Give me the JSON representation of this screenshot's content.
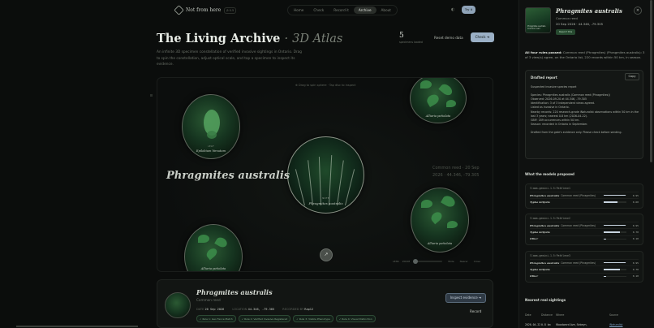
{
  "nav": {
    "logo_text": "Not from here",
    "logo_badge": "β 0.5",
    "tabs": [
      {
        "label": "Home",
        "active": false
      },
      {
        "label": "Check",
        "active": false
      },
      {
        "label": "Record it",
        "active": false
      },
      {
        "label": "Archive",
        "active": true
      },
      {
        "label": "About",
        "active": false
      }
    ],
    "glyph": "◐",
    "pill_label": "Try it"
  },
  "hero": {
    "title": "The Living Archive",
    "title_sep": "·",
    "title_sub": "3D Atlas",
    "intro": "An infinite 3D specimen constellation of verified invasive sightings in Ontario. Drag to spin the constellation, adjust optical scale, and tap a specimen to inspect its evidence.",
    "stat_count": "5",
    "stat_label": "specimens loaded",
    "reset_label": "Reset demo data",
    "check_label": "Check ➔"
  },
  "stage": {
    "hint": "⊕ Drag to spin sphere · Tap disc to inspect",
    "big_name": "Phragmites australis",
    "side_note": "Common reed · 20 Sep 2026 · 44.346, -79.305",
    "fab_icon": "↗",
    "slider_left": "LENS",
    "slider_zoom": "ZOOM",
    "slider_opts": [
      "Wide",
      "Nearer",
      "Close"
    ],
    "specimens": [
      {
        "label": "Epilobium hirsutum",
        "caps": "LEAF"
      },
      {
        "label": "Alliaria petiolata",
        "caps": ""
      },
      {
        "label": "Phragmites australis",
        "caps": "NOTE"
      },
      {
        "label": "Alliaria petiolata",
        "caps": ""
      },
      {
        "label": "Alliaria petiolata",
        "caps": ""
      }
    ]
  },
  "card": {
    "title": "Phragmites australis",
    "subtitle": "Common reed",
    "date_label": "DATE",
    "date_value": "20 Sep 2026",
    "loc_label": "LOCATION",
    "loc_value": "44.346, -79.305",
    "recorded_label": "RECORDED BY",
    "recorded_value": "Rap12",
    "tags": [
      "✓ Rule 1: Geo Fence Match",
      "✓ Rule 2: Verified Invasive Registered",
      "✓ Rule 3: Visible Phenotype",
      "✓ Rule 4: Visual Distinction"
    ],
    "inspect_label": "Inspect evidence ➔",
    "record_label": "Record"
  },
  "panel": {
    "thumb_caption": "Phragmites australis Common reed",
    "name": "Phragmites australis",
    "common": "Common reed",
    "observed": "20 Sep 2026 · 44.346, -79.305",
    "report_btn": "Report this",
    "close_icon": "×",
    "rules_lead": "All four rules passed:",
    "rules_text": " Common reed (Phragmites) (Phragmites australis): 3 of 3 view(s) agree, on the Ontario list, 220 records within 50 km, in season.",
    "draft": {
      "title": "Drafted report",
      "copy_label": "Copy",
      "heading": "Suspected invasive species report",
      "lines": [
        "Species: Phragmites australis (Common reed (Phragmites))",
        "Observed: 2026-09-20 at 44.346, -79.305",
        "Identification: 3 of 3 independent views agreed.",
        "Listed as invasive in Ontario.",
        "Nearby records: 220 research-grade iNaturalist observations within 50 km in the last 3 years; nearest 0.8 km (2026-04-22).",
        "GBIF: 189 occurrences within 50 km.",
        "Season: recorded in Ontario in September."
      ],
      "footer": "Drafted from the gate's evidence only. Please check before sending."
    },
    "models_title": "What the models proposed",
    "models": [
      {
        "id": "llama-gemini-1.5:Pathlene1",
        "rows": [
          {
            "sci": "Phragmites australis",
            "common": "Common reed (Phragmites)",
            "value": 0.95
          },
          {
            "sci": "Typha latifolia",
            "common": "",
            "value": 0.6
          }
        ]
      },
      {
        "id": "llama-gemini-1.5:Pathlene2",
        "rows": [
          {
            "sci": "Phragmites australis",
            "common": "Common reed (Phragmites)",
            "value": 0.95
          },
          {
            "sci": "Typha latifolia",
            "common": "",
            "value": 0.7
          },
          {
            "sci": "Other",
            "common": "",
            "value": 0.1
          }
        ]
      },
      {
        "id": "llama-gemini-1.5:Pathlene3",
        "rows": [
          {
            "sci": "Phragmites australis",
            "common": "Common reed (Phragmites)",
            "value": 0.95
          },
          {
            "sci": "Typha latifolia",
            "common": "",
            "value": 0.7
          },
          {
            "sci": "Other",
            "common": "",
            "value": 0.1
          }
        ]
      }
    ],
    "sightings_title": "Nearest real sightings",
    "sightings_cols": [
      "Date",
      "Distance",
      "Where",
      "Source"
    ],
    "sightings": [
      {
        "date": "2026-04-22",
        "dist": "0.8 km",
        "where": "Woodward Ave, Sebeyn,",
        "source": "iNaturalist"
      }
    ]
  }
}
